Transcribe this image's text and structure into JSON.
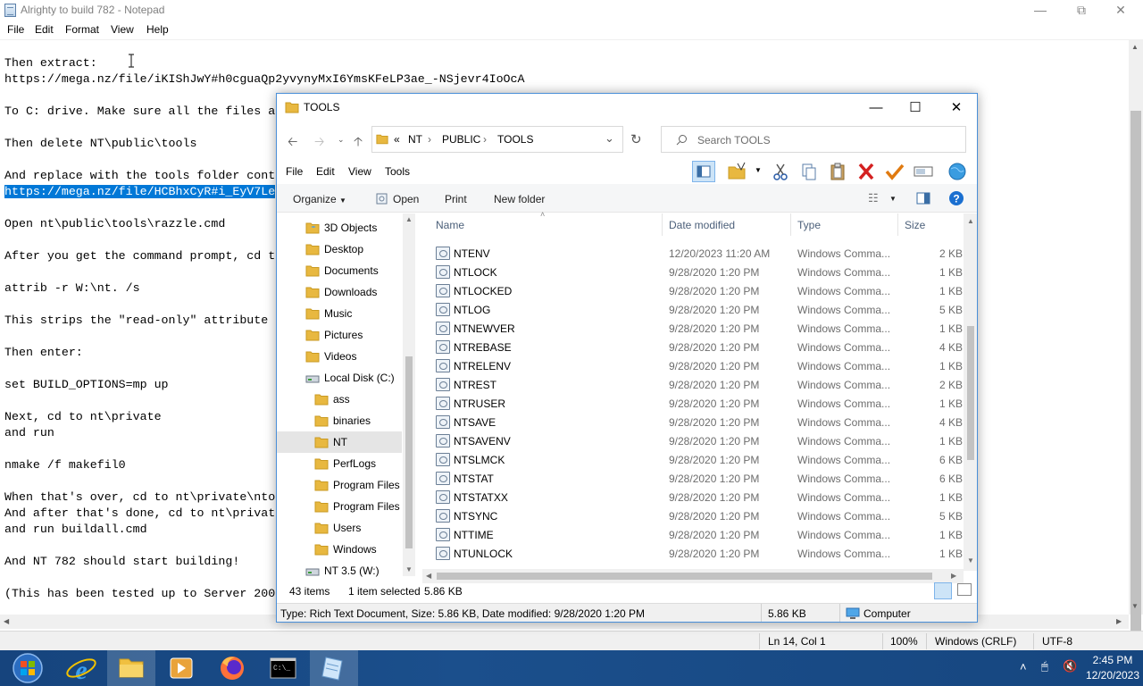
{
  "notepad": {
    "title": "Alrighty to build 782 - Notepad",
    "menu": [
      "File",
      "Edit",
      "Format",
      "View",
      "Help"
    ],
    "lines": [
      "Then extract:",
      "https://mega.nz/file/iKIShJwY#h0cguaQp2yvynyMxI6YmsKFeLP3ae_-NSjevr4IoOcA",
      "",
      "To C: drive. Make sure all the files a",
      "",
      "Then delete NT\\public\\tools",
      "",
      "And replace with the tools folder cont",
      "https://mega.nz/file/HCBhxCyR#i_EyV7Le",
      "",
      "Open nt\\public\\tools\\razzle.cmd",
      "",
      "After you get the command prompt, cd t",
      "",
      "attrib -r W:\\nt. /s",
      "",
      "This strips the \"read-only\" attribute",
      "",
      "Then enter:",
      "",
      "set BUILD_OPTIONS=mp up",
      "",
      "Next, cd to nt\\private",
      "and run",
      "",
      "nmake /f makefil0",
      "",
      "When that's over, cd to nt\\private\\nto",
      "And after that's done, cd to nt\\privat",
      "and run buildall.cmd",
      "",
      "And NT 782 should start building!",
      "",
      "(This has been tested up to Server 200"
    ],
    "status": {
      "position": "Ln 14, Col 1",
      "zoom": "100%",
      "line_ending": "Windows (CRLF)",
      "encoding": "UTF-8"
    }
  },
  "explorer": {
    "title": "TOOLS",
    "breadcrumb": [
      "«",
      "NT",
      "PUBLIC",
      "TOOLS"
    ],
    "search_placeholder": "Search TOOLS",
    "menu": [
      "File",
      "Edit",
      "View",
      "Tools"
    ],
    "commands": {
      "organize": "Organize",
      "open": "Open",
      "print": "Print",
      "new_folder": "New folder"
    },
    "nav": [
      {
        "label": "3D Objects",
        "level": 1,
        "icon": "3d-objects-icon"
      },
      {
        "label": "Desktop",
        "level": 1,
        "icon": "folder-icon"
      },
      {
        "label": "Documents",
        "level": 1,
        "icon": "folder-icon"
      },
      {
        "label": "Downloads",
        "level": 1,
        "icon": "folder-icon"
      },
      {
        "label": "Music",
        "level": 1,
        "icon": "folder-icon"
      },
      {
        "label": "Pictures",
        "level": 1,
        "icon": "folder-icon"
      },
      {
        "label": "Videos",
        "level": 1,
        "icon": "folder-icon"
      },
      {
        "label": "Local Disk (C:)",
        "level": 1,
        "icon": "drive-icon"
      },
      {
        "label": "ass",
        "level": 2,
        "icon": "folder-icon"
      },
      {
        "label": "binaries",
        "level": 2,
        "icon": "folder-icon"
      },
      {
        "label": "NT",
        "level": 2,
        "icon": "folder-icon",
        "selected": true
      },
      {
        "label": "PerfLogs",
        "level": 2,
        "icon": "folder-icon"
      },
      {
        "label": "Program Files",
        "level": 2,
        "icon": "folder-icon"
      },
      {
        "label": "Program Files (",
        "level": 2,
        "icon": "folder-icon"
      },
      {
        "label": "Users",
        "level": 2,
        "icon": "folder-icon"
      },
      {
        "label": "Windows",
        "level": 2,
        "icon": "folder-icon"
      },
      {
        "label": "NT 3.5 (W:)",
        "level": 1,
        "icon": "drive-icon"
      }
    ],
    "columns": [
      "Name",
      "Date modified",
      "Type",
      "Size"
    ],
    "files": [
      {
        "name": "NTENV",
        "date": "12/20/2023 11:20 AM",
        "type": "Windows Comma...",
        "size": "2 KB"
      },
      {
        "name": "NTLOCK",
        "date": "9/28/2020 1:20 PM",
        "type": "Windows Comma...",
        "size": "1 KB"
      },
      {
        "name": "NTLOCKED",
        "date": "9/28/2020 1:20 PM",
        "type": "Windows Comma...",
        "size": "1 KB"
      },
      {
        "name": "NTLOG",
        "date": "9/28/2020 1:20 PM",
        "type": "Windows Comma...",
        "size": "5 KB"
      },
      {
        "name": "NTNEWVER",
        "date": "9/28/2020 1:20 PM",
        "type": "Windows Comma...",
        "size": "1 KB"
      },
      {
        "name": "NTREBASE",
        "date": "9/28/2020 1:20 PM",
        "type": "Windows Comma...",
        "size": "4 KB"
      },
      {
        "name": "NTRELENV",
        "date": "9/28/2020 1:20 PM",
        "type": "Windows Comma...",
        "size": "1 KB"
      },
      {
        "name": "NTREST",
        "date": "9/28/2020 1:20 PM",
        "type": "Windows Comma...",
        "size": "2 KB"
      },
      {
        "name": "NTRUSER",
        "date": "9/28/2020 1:20 PM",
        "type": "Windows Comma...",
        "size": "1 KB"
      },
      {
        "name": "NTSAVE",
        "date": "9/28/2020 1:20 PM",
        "type": "Windows Comma...",
        "size": "4 KB"
      },
      {
        "name": "NTSAVENV",
        "date": "9/28/2020 1:20 PM",
        "type": "Windows Comma...",
        "size": "1 KB"
      },
      {
        "name": "NTSLMCK",
        "date": "9/28/2020 1:20 PM",
        "type": "Windows Comma...",
        "size": "6 KB"
      },
      {
        "name": "NTSTAT",
        "date": "9/28/2020 1:20 PM",
        "type": "Windows Comma...",
        "size": "6 KB"
      },
      {
        "name": "NTSTATXX",
        "date": "9/28/2020 1:20 PM",
        "type": "Windows Comma...",
        "size": "1 KB"
      },
      {
        "name": "NTSYNC",
        "date": "9/28/2020 1:20 PM",
        "type": "Windows Comma...",
        "size": "5 KB"
      },
      {
        "name": "NTTIME",
        "date": "9/28/2020 1:20 PM",
        "type": "Windows Comma...",
        "size": "1 KB"
      },
      {
        "name": "NTUNLOCK",
        "date": "9/28/2020 1:20 PM",
        "type": "Windows Comma...",
        "size": "1 KB"
      }
    ],
    "status": {
      "items": "43 items",
      "selected": "1 item selected",
      "selected_size": "5.86 KB",
      "details": "Type: Rich Text Document, Size: 5.86 KB, Date modified: 9/28/2020 1:20 PM",
      "size2": "5.86 KB",
      "location": "Computer"
    }
  },
  "taskbar": {
    "apps": [
      "start-orb-icon",
      "internet-explorer-icon",
      "file-explorer-icon",
      "media-player-icon",
      "firefox-icon",
      "command-prompt-icon",
      "notepad-icon"
    ],
    "clock_time": "2:45 PM",
    "clock_date": "12/20/2023"
  },
  "colors": {
    "selection": "#0078d7",
    "taskbar": "#1b4f8c",
    "explorer_border": "#4a8fd8"
  }
}
